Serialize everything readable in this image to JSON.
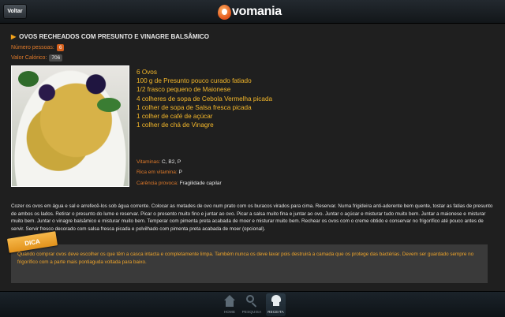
{
  "header": {
    "back_label": "Voltar",
    "logo_text": "vomania"
  },
  "recipe": {
    "title": "OVOS RECHEADOS COM PRESUNTO E VINAGRE BALSÂMICO",
    "servings_label": "Número pessoas:",
    "servings_value": "6",
    "calories_label": "Valor Calórico:",
    "calories_value": "706",
    "ingredients": [
      "6 Ovos",
      "100 g de Presunto pouco curado fatiado",
      "1/2 frasco pequeno de Maionese",
      "4 colheres de sopa de Cebola Vermelha picada",
      "1 colher de sopa de Salsa fresca picada",
      "1 colher de café de açúcar",
      "1 colher de chá de Vinagre"
    ],
    "vitamins_label": "Vitaminas:",
    "vitamins_value": "C, B2, P",
    "rich_label": "Rica em vitamina:",
    "rich_value": "P",
    "deficiency_label": "Carência provoca:",
    "deficiency_value": "Fragilidade capilar",
    "instructions": "Cozer os ovos em água e sal e arrefecê-los sob água corrente. Colocar as metades de ovo num prato com os buracos virados para cima. Reservar. Numa frigideira anti-aderente bem quente, tostar as fatias de presunto de ambos os lados. Retirar o presunto do lume e reservar. Picar o presento muito fino e juntar ao ovo. Picar a salsa muito fina e juntar ao ovo. Juntar o açúcar e misturar tudo muito bem. Juntar a maionese e misturar muito bem. Juntar o vinagre balsâmico e misturar muito bem. Temperar com pimenta preta acabada de moer e misturar muito bem. Rechear os ovos com o creme obtido e conservar no frigorífico até pouco antes de servir. Servir fresco decorado com salsa fresca picada e polvilhado com pimenta preta acabada de moer (opcional)."
  },
  "tip": {
    "badge": "DICA",
    "text": "Quando comprar ovos deve escolher os que têm a casca intacta e completamente limpa. Também nunca os deve lavar pois destruirá a camada que os protege das bactérias. Devem ser guardado sempre no frigorífico com a parte mais pontiaguda voltada para baixo."
  },
  "tabs": [
    {
      "label": "HOME",
      "icon": "home-icon"
    },
    {
      "label": "PESQUISA",
      "icon": "search-icon"
    },
    {
      "label": "RECEITA",
      "icon": "chef-hat-icon",
      "active": true
    }
  ],
  "colors": {
    "accent": "#f5b82a",
    "label_orange": "#e07a2a",
    "brand_orange": "#e2561c"
  }
}
